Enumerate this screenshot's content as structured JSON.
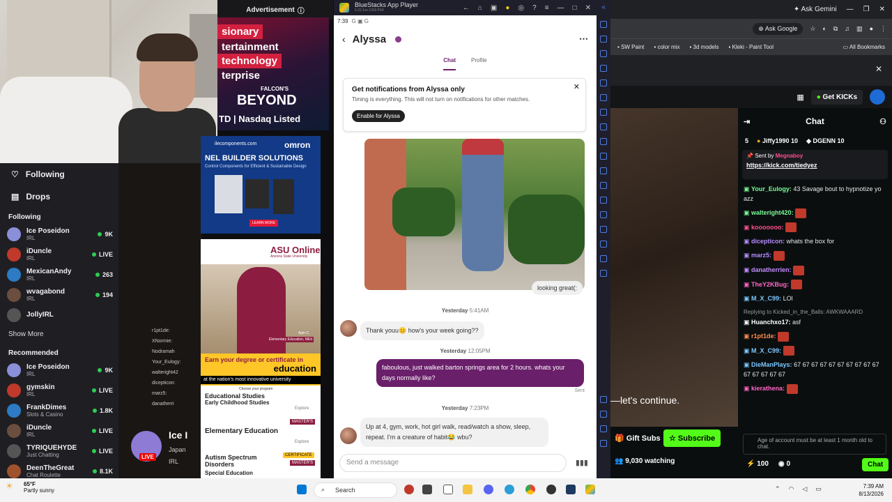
{
  "ads": {
    "label": "Advertisement",
    "ad1": {
      "line1": "sionary",
      "line2": "tertainment",
      "line3": "technology",
      "line4": "terprise",
      "brand_small": "FALCON'S",
      "brand": "BEYOND",
      "listed": "TD | Nasdaq Listed"
    },
    "ad2": {
      "domain": "ilecomponents.com",
      "brand": "omron",
      "headline": "NEL BUILDER SOLUTIONS",
      "sub": "Control Components for Efficient & Sustainable Design",
      "cta": "LEARN MORE"
    },
    "ad3": {
      "brand": "ASU Online",
      "school": "Arizona State University",
      "tagline1": "Earn your degree or certificate in",
      "tagline2": "education",
      "tagline3": "at the nation's most innovative university",
      "choose": "Choose your program",
      "badge_name": "Ajah C.",
      "badge_role": "Elementary Education, MEd",
      "programs": [
        {
          "title": "Educational Studies",
          "sub": "Early Childhood Studies",
          "link": "Explore"
        },
        {
          "title": "Elementary Education",
          "tag": "MASTER'S",
          "link": "Explore"
        },
        {
          "title": "Autism Spectrum Disorders",
          "tag": "CERTIFICATE",
          "tag2": "MASTER'S",
          "sub": "Special Education"
        }
      ]
    }
  },
  "twitch": {
    "nav": {
      "following": "Following",
      "drops": "Drops"
    },
    "following_title": "Following",
    "following": [
      {
        "name": "Ice Poseidon",
        "category": "IRL",
        "viewers": "9K"
      },
      {
        "name": "iDuncle",
        "category": "IRL",
        "viewers": "LIVE"
      },
      {
        "name": "MexicanAndy",
        "category": "IRL",
        "viewers": "263"
      },
      {
        "name": "wvagabond",
        "category": "IRL",
        "viewers": "194"
      },
      {
        "name": "JollyIRL",
        "category": "",
        "viewers": ""
      }
    ],
    "show_more": "Show More",
    "recommended_title": "Recommended",
    "recommended": [
      {
        "name": "Ice Poseidon",
        "category": "IRL",
        "viewers": "9K"
      },
      {
        "name": "gymskin",
        "category": "IRL",
        "viewers": "LIVE"
      },
      {
        "name": "FrankDimes",
        "category": "Slots & Casino",
        "viewers": "1.8K"
      },
      {
        "name": "iDuncle",
        "category": "IRL",
        "viewers": "LIVE"
      },
      {
        "name": "TYRIQUEHYDE",
        "category": "Just Chatting",
        "viewers": "LIVE"
      },
      {
        "name": "DeenTheGreat",
        "category": "Chat Roulette",
        "viewers": "8.1K"
      }
    ],
    "stream_chat": [
      "r1pt1de:",
      "XNormie:",
      "Nodramah",
      "Your_Eulogy:",
      "walteright42",
      "dicepticon:",
      "marz5:",
      "danatherri"
    ],
    "live_badge": "LIVE",
    "live_name": "Ice I",
    "live_sub1": "Japan",
    "live_sub2": "IRL"
  },
  "bluestacks": {
    "title": "BlueStacks App Player",
    "version": "5.22.1xx.1003 P64",
    "time": "7:39",
    "status_icons": "G ▣ G",
    "app": {
      "name": "Alyssa",
      "tabs": [
        "Chat",
        "Profile"
      ],
      "active_tab": "Chat",
      "notif_title": "Get notifications from Alyssa only",
      "notif_body": "Timing is everything. This will not turn on notifications for other matches.",
      "notif_button": "Enable for Alyssa",
      "image_reply": "looking great(:",
      "messages": [
        {
          "ts_day": "Yesterday",
          "ts_time": "5:41AM",
          "dir": "in",
          "text": "Thank youu😊 how's your week going??"
        },
        {
          "ts_day": "Yesterday",
          "ts_time": "12:05PM",
          "dir": "out",
          "text": "faboulous, just walked barton springs area for 2 hours. whats your days normally like?"
        },
        {
          "ts_day": "Yesterday",
          "ts_time": "7:23PM",
          "dir": "in",
          "text": "Up at 4, gym, work, hot girl walk, read/watch a show, sleep, repeat. I'm a creature of habit😂 wbu?"
        }
      ],
      "sent_label": "Sent",
      "composer_placeholder": "Send a message"
    }
  },
  "browser": {
    "ask_gemini": "Ask Gemini",
    "ask_google": "Ask Google",
    "bookmarks": [
      "SW Paint",
      "color mix",
      "3d models",
      "Kleki - Paint Tool"
    ],
    "all_bookmarks": "All Bookmarks"
  },
  "kick": {
    "get_kicks": "Get KICKs",
    "chat_title": "Chat",
    "leader": [
      {
        "rank": "5",
        "name": ""
      },
      {
        "rank": "",
        "name": "Jiffy1990",
        "count": "10"
      },
      {
        "rank": "",
        "name": "DGENN",
        "count": "10"
      }
    ],
    "pinned_by": "Sent by",
    "pinned_user": "Megnaboy",
    "pinned_link": "https://kick.com/tiedyez",
    "messages": [
      {
        "user": "Your_Eulogy:",
        "text": "43 Savage bout to hypnotize yo azz",
        "color": "#7cfc98"
      },
      {
        "user": "walteright420:",
        "text": "",
        "color": "#7cfc98"
      },
      {
        "user": "kooooooo:",
        "text": "",
        "color": "#ff4d8d"
      },
      {
        "user": "dicepticon:",
        "text": "whats the box for",
        "color": "#b48cff"
      },
      {
        "user": "marz5:",
        "text": "",
        "color": "#b48cff"
      },
      {
        "user": "danatherrien:",
        "text": "",
        "color": "#c08cff"
      },
      {
        "user": "TheY2KBug:",
        "text": "",
        "color": "#ff66c4"
      },
      {
        "user": "M_X_C99:",
        "text": "LOl",
        "color": "#7cc8ff"
      },
      {
        "reply": "Replying to Kicked_in_the_Balls: AWKWAAARD",
        "user": "Huanchxo17:",
        "text": "asf",
        "color": "#ffffff"
      },
      {
        "user": "r1pt1de:",
        "text": "",
        "color": "#ff8c4d"
      },
      {
        "user": "M_X_C99:",
        "text": "",
        "color": "#7cc8ff"
      },
      {
        "user": "DieManPlays:",
        "text": "67 67 67 67 67 67 67 67 67 67 67 67 67 67 67",
        "color": "#7cc8ff"
      },
      {
        "user": "kierathena:",
        "text": "",
        "color": "#ff66c4"
      }
    ],
    "caption": "—let's continue.",
    "gift_subs": "Gift Subs",
    "subscribe": "Subscribe",
    "watching": "9,030 watching",
    "age_note": "Age of account must be at least 1 month old to chat.",
    "points": "100",
    "points2": "0",
    "chat_button": "Chat"
  },
  "taskbar": {
    "temp": "65°F",
    "weather": "Partly sunny",
    "search": "Search",
    "time": "7:39 AM",
    "date": "8/13/2026"
  }
}
